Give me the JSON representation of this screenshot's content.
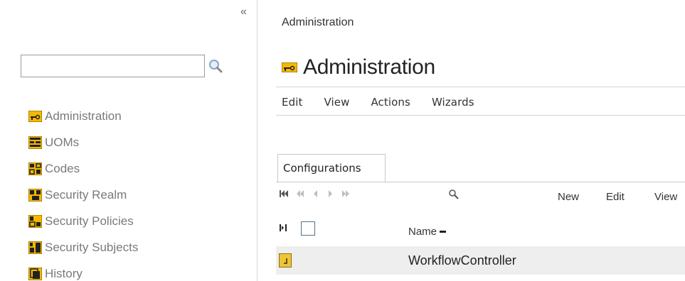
{
  "sidebar": {
    "collapse_glyph": "«",
    "search": {
      "value": "",
      "icon": "search-icon"
    },
    "items": [
      {
        "label": "Administration",
        "icon": "key-icon"
      },
      {
        "label": "UOMs",
        "icon": "uom-icon"
      },
      {
        "label": "Codes",
        "icon": "codes-icon"
      },
      {
        "label": "Security Realm",
        "icon": "security-realm-icon"
      },
      {
        "label": "Security Policies",
        "icon": "security-policies-icon"
      },
      {
        "label": "Security Subjects",
        "icon": "security-subjects-icon"
      },
      {
        "label": "History",
        "icon": "history-icon"
      }
    ]
  },
  "main": {
    "breadcrumb": "Administration",
    "title": "Administration",
    "title_icon": "key-icon",
    "menu": [
      "Edit",
      "View",
      "Actions",
      "Wizards"
    ],
    "tab": "Configurations",
    "toolbar": {
      "pager_icons": [
        "first-page-icon",
        "previous-page-icon",
        "previous-icon",
        "next-icon",
        "last-page-icon"
      ],
      "search_icon": "search-icon",
      "buttons": [
        "New",
        "Edit",
        "View"
      ]
    },
    "table": {
      "columns": [
        "Name"
      ],
      "sort_indicator": "−",
      "rows": [
        {
          "name": "WorkflowController",
          "icon": "configuration-icon"
        }
      ]
    }
  },
  "colors": {
    "icon_yellow": "#f5b800",
    "row_highlight": "#eeeeee",
    "nav_text": "#7a7a7a"
  }
}
